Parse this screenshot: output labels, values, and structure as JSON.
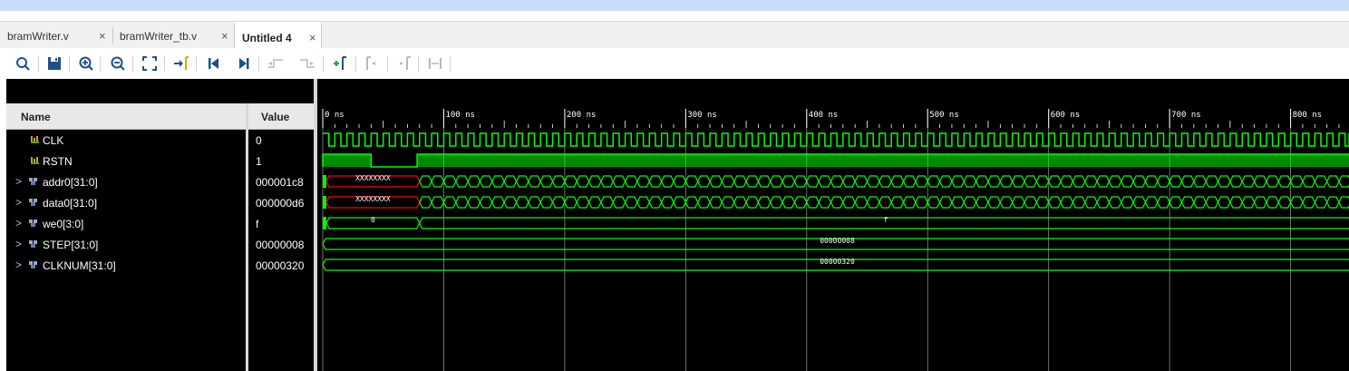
{
  "tabs": [
    {
      "label": "bramWriter.v",
      "active": false
    },
    {
      "label": "bramWriter_tb.v",
      "active": false
    },
    {
      "label": "Untitled 4",
      "active": true
    }
  ],
  "tab_close_glyph": "×",
  "toolbar": [
    {
      "icon": "search-icon",
      "tooltip": ""
    },
    {
      "icon": "save-icon",
      "tooltip": ""
    },
    {
      "icon": "zoom-in-icon",
      "tooltip": ""
    },
    {
      "icon": "zoom-out-icon",
      "tooltip": ""
    },
    {
      "icon": "zoom-fit-icon",
      "tooltip": ""
    },
    {
      "icon": "go-to-cursor-icon",
      "tooltip": ""
    },
    {
      "icon": "go-to-time-0-icon",
      "tooltip": ""
    },
    {
      "icon": "go-to-last-time-icon",
      "tooltip": ""
    },
    {
      "icon": "previous-transition-icon",
      "tooltip": ""
    },
    {
      "icon": "next-transition-icon",
      "tooltip": ""
    },
    {
      "icon": "add-marker-icon",
      "tooltip": ""
    },
    {
      "icon": "previous-marker-icon",
      "tooltip": ""
    },
    {
      "icon": "next-marker-icon",
      "tooltip": ""
    },
    {
      "icon": "swap-cursors-icon",
      "tooltip": ""
    }
  ],
  "columns": {
    "name": "Name",
    "value": "Value"
  },
  "signals": [
    {
      "name": "CLK",
      "value": "0",
      "kind": "bit",
      "expandable": false
    },
    {
      "name": "RSTN",
      "value": "1",
      "kind": "bit",
      "expandable": false
    },
    {
      "name": "addr0[31:0]",
      "value": "000001c8",
      "kind": "bus",
      "expandable": true
    },
    {
      "name": "data0[31:0]",
      "value": "000000d6",
      "kind": "bus",
      "expandable": true
    },
    {
      "name": "we0[3:0]",
      "value": "f",
      "kind": "bus",
      "expandable": true
    },
    {
      "name": "STEP[31:0]",
      "value": "00000008",
      "kind": "bus",
      "expandable": true
    },
    {
      "name": "CLKNUM[31:0]",
      "value": "00000320",
      "kind": "bus",
      "expandable": true
    }
  ],
  "timeline": {
    "labels": [
      "0 ns",
      "100 ns",
      "200 ns",
      "300 ns",
      "400 ns",
      "500 ns",
      "600 ns",
      "700 ns",
      "800 ns"
    ],
    "step_ns": 100
  },
  "waves": {
    "clk_period_ns": 10,
    "rstn_low_start_ns": 40,
    "rstn_low_end_ns": 78,
    "unknown_end_ns": 80,
    "bus_period_ns": 10,
    "addr0_initial": "XXXXXXXX",
    "data0_initial": "XXXXXXXX",
    "we0_initial": "0",
    "we0_after": "f",
    "step_value": "00000008",
    "clknum_value": "00000320"
  },
  "colors": {
    "wave": "#00ff00",
    "unknown": "#ff0000",
    "grid": "#ffffff",
    "text": "#ffffff",
    "tab_active_bg": "#ffffff",
    "marker_green": "#22aa22"
  }
}
